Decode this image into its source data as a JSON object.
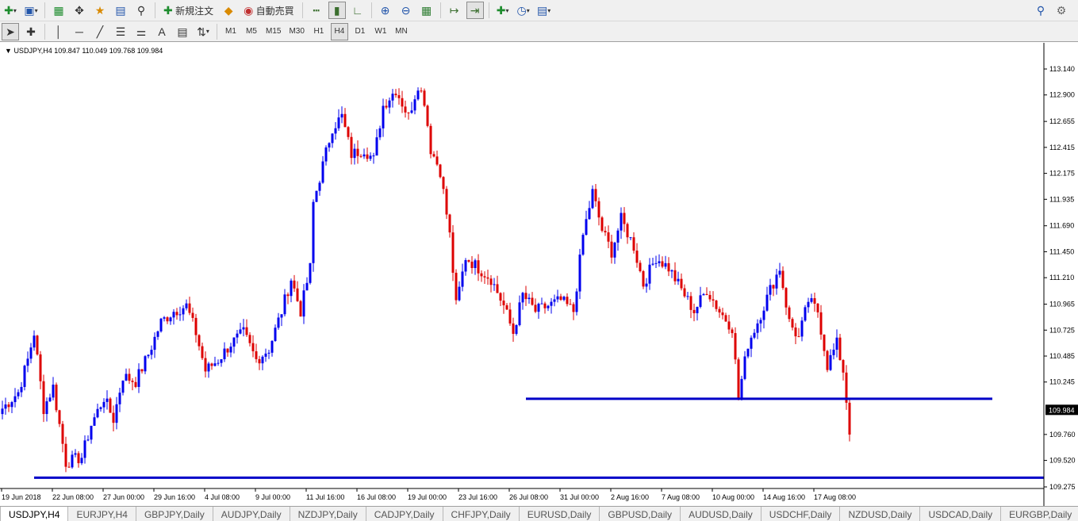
{
  "toolbar_main": {
    "new_order_label": "新規注文",
    "auto_trade_label": "自動売買"
  },
  "toolbar_timeframes": [
    "M1",
    "M5",
    "M15",
    "M30",
    "H1",
    "H4",
    "D1",
    "W1",
    "MN"
  ],
  "active_timeframe": "H4",
  "symbol_info": "USDJPY,H4  109.847 110.049 109.768 109.984",
  "current_price": "109.984",
  "price_axis": {
    "ticks": [
      "113.140",
      "112.900",
      "112.655",
      "112.415",
      "112.175",
      "111.935",
      "111.690",
      "111.450",
      "111.210",
      "110.965",
      "110.725",
      "110.485",
      "110.245",
      "109.760",
      "109.520",
      "109.275"
    ],
    "tick_values": [
      113.14,
      112.9,
      112.655,
      112.415,
      112.175,
      111.935,
      111.69,
      111.45,
      111.21,
      110.965,
      110.725,
      110.485,
      110.245,
      109.76,
      109.52,
      109.275
    ]
  },
  "time_axis": [
    "19 Jun 2018",
    "22 Jun 08:00",
    "27 Jun 00:00",
    "29 Jun 16:00",
    "4 Jul 08:00",
    "9 Jul 00:00",
    "11 Jul 16:00",
    "16 Jul 08:00",
    "19 Jul 00:00",
    "23 Jul 16:00",
    "26 Jul 08:00",
    "31 Jul 00:00",
    "2 Aug 16:00",
    "7 Aug 08:00",
    "10 Aug 00:00",
    "14 Aug 16:00",
    "17 Aug 08:00"
  ],
  "tabs": [
    "USDJPY,H4",
    "EURJPY,H4",
    "GBPJPY,Daily",
    "AUDJPY,Daily",
    "NZDJPY,Daily",
    "CADJPY,Daily",
    "CHFJPY,Daily",
    "EURUSD,Daily",
    "GBPUSD,Daily",
    "AUDUSD,Daily",
    "USDCHF,Daily",
    "NZDUSD,Daily",
    "USDCAD,Daily",
    "EURGBP,Daily"
  ],
  "active_tab": "USDJPY,H4",
  "colors": {
    "bull": "#0000ee",
    "bear": "#dd0000",
    "hline": "#0000c8",
    "grid": "#ffffff",
    "axis": "#000000"
  },
  "chart_data": {
    "type": "candlestick",
    "symbol": "USDJPY",
    "timeframe": "H4",
    "ylim": [
      109.275,
      113.14
    ],
    "horizontal_lines": [
      {
        "price": 110.09,
        "x_start_index": 165,
        "x_end_index": 312
      },
      {
        "price": 109.36,
        "x_start_index": 10,
        "x_end_index": 340
      }
    ],
    "waypoints": [
      {
        "i": 0,
        "p": 110.0
      },
      {
        "i": 5,
        "p": 110.15
      },
      {
        "i": 8,
        "p": 110.45
      },
      {
        "i": 10,
        "p": 110.7
      },
      {
        "i": 13,
        "p": 110.0
      },
      {
        "i": 16,
        "p": 110.2
      },
      {
        "i": 20,
        "p": 109.5
      },
      {
        "i": 25,
        "p": 109.55
      },
      {
        "i": 28,
        "p": 109.85
      },
      {
        "i": 32,
        "p": 110.1
      },
      {
        "i": 35,
        "p": 109.9
      },
      {
        "i": 38,
        "p": 110.3
      },
      {
        "i": 42,
        "p": 110.25
      },
      {
        "i": 46,
        "p": 110.5
      },
      {
        "i": 50,
        "p": 110.8
      },
      {
        "i": 54,
        "p": 110.9
      },
      {
        "i": 58,
        "p": 110.95
      },
      {
        "i": 61,
        "p": 110.7
      },
      {
        "i": 64,
        "p": 110.35
      },
      {
        "i": 68,
        "p": 110.45
      },
      {
        "i": 72,
        "p": 110.6
      },
      {
        "i": 76,
        "p": 110.7
      },
      {
        "i": 80,
        "p": 110.45
      },
      {
        "i": 84,
        "p": 110.55
      },
      {
        "i": 88,
        "p": 110.9
      },
      {
        "i": 91,
        "p": 111.2
      },
      {
        "i": 94,
        "p": 110.9
      },
      {
        "i": 97,
        "p": 111.3
      },
      {
        "i": 98,
        "p": 111.9
      },
      {
        "i": 101,
        "p": 112.25
      },
      {
        "i": 104,
        "p": 112.6
      },
      {
        "i": 107,
        "p": 112.7
      },
      {
        "i": 110,
        "p": 112.35
      },
      {
        "i": 114,
        "p": 112.4
      },
      {
        "i": 117,
        "p": 112.3
      },
      {
        "i": 120,
        "p": 112.8
      },
      {
        "i": 124,
        "p": 112.95
      },
      {
        "i": 128,
        "p": 112.7
      },
      {
        "i": 131,
        "p": 113.0
      },
      {
        "i": 133,
        "p": 112.85
      },
      {
        "i": 135,
        "p": 112.4
      },
      {
        "i": 138,
        "p": 112.2
      },
      {
        "i": 141,
        "p": 111.6
      },
      {
        "i": 143,
        "p": 110.95
      },
      {
        "i": 146,
        "p": 111.4
      },
      {
        "i": 150,
        "p": 111.3
      },
      {
        "i": 154,
        "p": 111.2
      },
      {
        "i": 158,
        "p": 110.95
      },
      {
        "i": 161,
        "p": 110.7
      },
      {
        "i": 164,
        "p": 111.05
      },
      {
        "i": 168,
        "p": 110.9
      },
      {
        "i": 172,
        "p": 110.95
      },
      {
        "i": 176,
        "p": 111.0
      },
      {
        "i": 180,
        "p": 110.9
      },
      {
        "i": 183,
        "p": 111.6
      },
      {
        "i": 186,
        "p": 112.0
      },
      {
        "i": 189,
        "p": 111.65
      },
      {
        "i": 192,
        "p": 111.45
      },
      {
        "i": 195,
        "p": 111.75
      },
      {
        "i": 199,
        "p": 111.5
      },
      {
        "i": 202,
        "p": 111.15
      },
      {
        "i": 206,
        "p": 111.4
      },
      {
        "i": 210,
        "p": 111.3
      },
      {
        "i": 214,
        "p": 111.1
      },
      {
        "i": 218,
        "p": 110.9
      },
      {
        "i": 222,
        "p": 111.1
      },
      {
        "i": 226,
        "p": 110.9
      },
      {
        "i": 230,
        "p": 110.75
      },
      {
        "i": 232,
        "p": 110.1
      },
      {
        "i": 235,
        "p": 110.6
      },
      {
        "i": 238,
        "p": 110.8
      },
      {
        "i": 242,
        "p": 111.1
      },
      {
        "i": 245,
        "p": 111.3
      },
      {
        "i": 248,
        "p": 110.8
      },
      {
        "i": 251,
        "p": 110.65
      },
      {
        "i": 254,
        "p": 111.0
      },
      {
        "i": 257,
        "p": 110.9
      },
      {
        "i": 260,
        "p": 110.4
      },
      {
        "i": 263,
        "p": 110.6
      },
      {
        "i": 265,
        "p": 110.35
      },
      {
        "i": 267,
        "p": 109.8
      }
    ]
  }
}
